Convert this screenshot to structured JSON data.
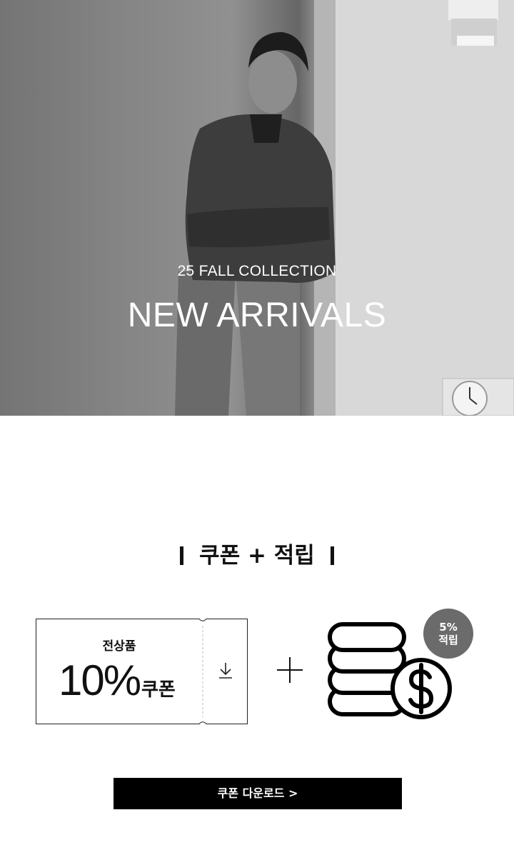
{
  "hero": {
    "subtitle": "25 FALL COLLECTION",
    "title": "NEW ARRIVALS"
  },
  "benefit": {
    "title": "쿠폰 + 적립"
  },
  "coupon": {
    "label": "전상품",
    "percent": "10%",
    "word": "쿠폰",
    "icon": "download-icon"
  },
  "points": {
    "badge_line1": "5%",
    "badge_line2": "적립",
    "icon": "coin-stack-dollar-icon"
  },
  "cta": {
    "label": "쿠폰 다운로드 >"
  }
}
